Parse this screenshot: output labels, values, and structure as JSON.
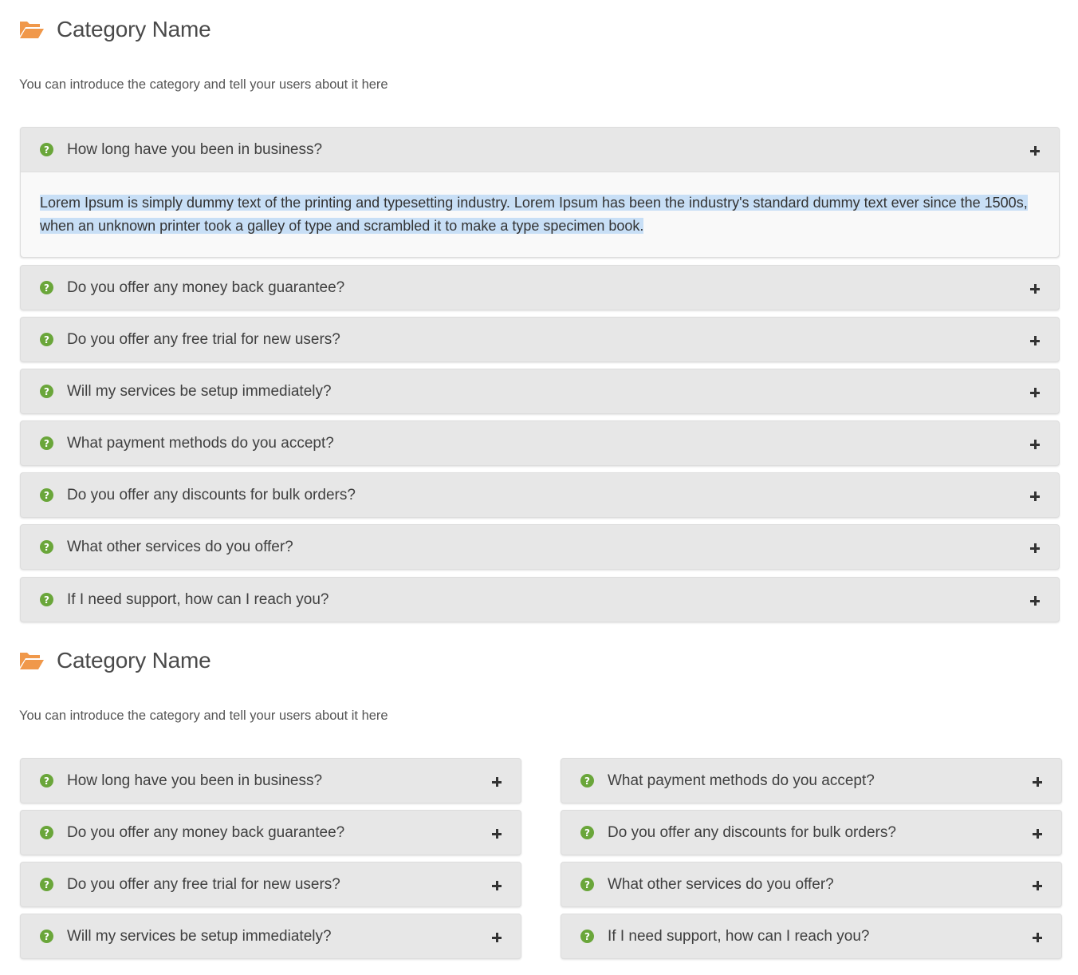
{
  "colors": {
    "folder_icon": "#f0984a",
    "question_icon": "#6aa63a",
    "item_background": "#e7e7e7",
    "selection_highlight": "#c8dff6"
  },
  "sections": [
    {
      "icon": "folder-open-icon",
      "title": "Category Name",
      "description": "You can introduce the category and tell your users about it here",
      "layout": "single-column",
      "items": [
        {
          "question": "How long have you been in business?",
          "expanded": true,
          "answer": "Lorem Ipsum is simply dummy text of the printing and typesetting industry. Lorem Ipsum has been the industry's standard dummy text ever since the 1500s, when an unknown printer took a galley of type and scrambled it to make a type specimen book."
        },
        {
          "question": "Do you offer any money back guarantee?",
          "expanded": false
        },
        {
          "question": "Do you offer any free trial for new users?",
          "expanded": false
        },
        {
          "question": "Will my services be setup immediately?",
          "expanded": false
        },
        {
          "question": "What payment methods do you accept?",
          "expanded": false
        },
        {
          "question": "Do you offer any discounts for bulk orders?",
          "expanded": false
        },
        {
          "question": "What other services do you offer?",
          "expanded": false
        },
        {
          "question": "If I need support, how can I reach you?",
          "expanded": false
        }
      ]
    },
    {
      "icon": "folder-open-icon",
      "title": "Category Name",
      "description": "You can introduce the category and tell your users about it here",
      "layout": "two-column",
      "left_items": [
        {
          "question": "How long have you been in business?",
          "expanded": false
        },
        {
          "question": "Do you offer any money back guarantee?",
          "expanded": false
        },
        {
          "question": "Do you offer any free trial for new users?",
          "expanded": false
        },
        {
          "question": "Will my services be setup immediately?",
          "expanded": false
        }
      ],
      "right_items": [
        {
          "question": "What payment methods do you accept?",
          "expanded": false
        },
        {
          "question": "Do you offer any discounts for bulk orders?",
          "expanded": false
        },
        {
          "question": "What other services do you offer?",
          "expanded": false
        },
        {
          "question": "If I need support, how can I reach you?",
          "expanded": false
        }
      ]
    }
  ]
}
